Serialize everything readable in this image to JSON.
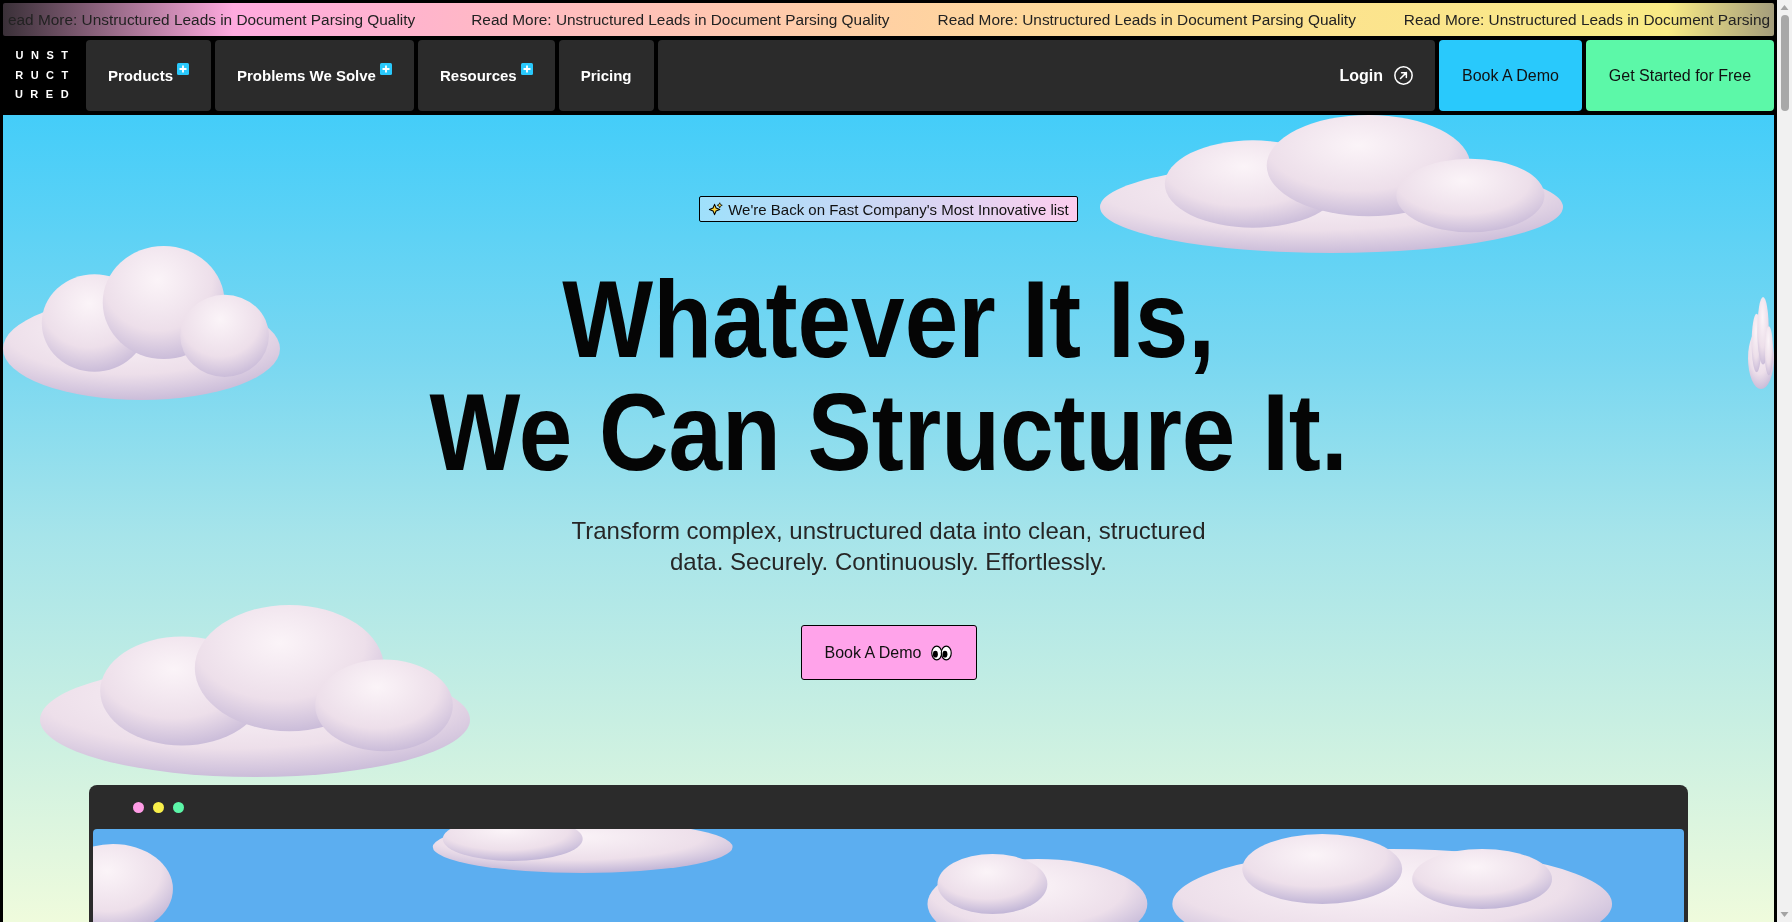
{
  "announcement_bar": {
    "items": [
      "ead More: Unstructured Leads in Document Parsing Quality",
      "Read More: Unstructured Leads in Document Parsing Quality",
      "Read More: Unstructured Leads in Document Parsing Quality",
      "Read More: Unstructured Leads in Document Parsing"
    ]
  },
  "nav": {
    "logo": [
      "UNST",
      "RUCT",
      "URED"
    ],
    "menu": [
      {
        "label": "Products",
        "expandable": true
      },
      {
        "label": "Problems We Solve",
        "expandable": true
      },
      {
        "label": "Resources",
        "expandable": true
      },
      {
        "label": "Pricing",
        "expandable": false
      }
    ],
    "login": "Login",
    "buttons": [
      {
        "label": "Book A Demo",
        "kind": "demo"
      },
      {
        "label": "Get Started for Free",
        "kind": "signup"
      }
    ]
  },
  "hero": {
    "badge": "We're Back on Fast Company's Most Innovative list",
    "heading": [
      "Whatever It Is,",
      "We Can Structure It."
    ],
    "subtitle": "Transform complex, unstructured data into clean, structured data. Securely. Continuously. Effortlessly.",
    "cta": "Book A Demo"
  },
  "preview_window": {
    "dots": [
      {
        "color": "#ff9de6"
      },
      {
        "color": "#f8ef4a"
      },
      {
        "color": "#5cf6a8"
      }
    ]
  }
}
